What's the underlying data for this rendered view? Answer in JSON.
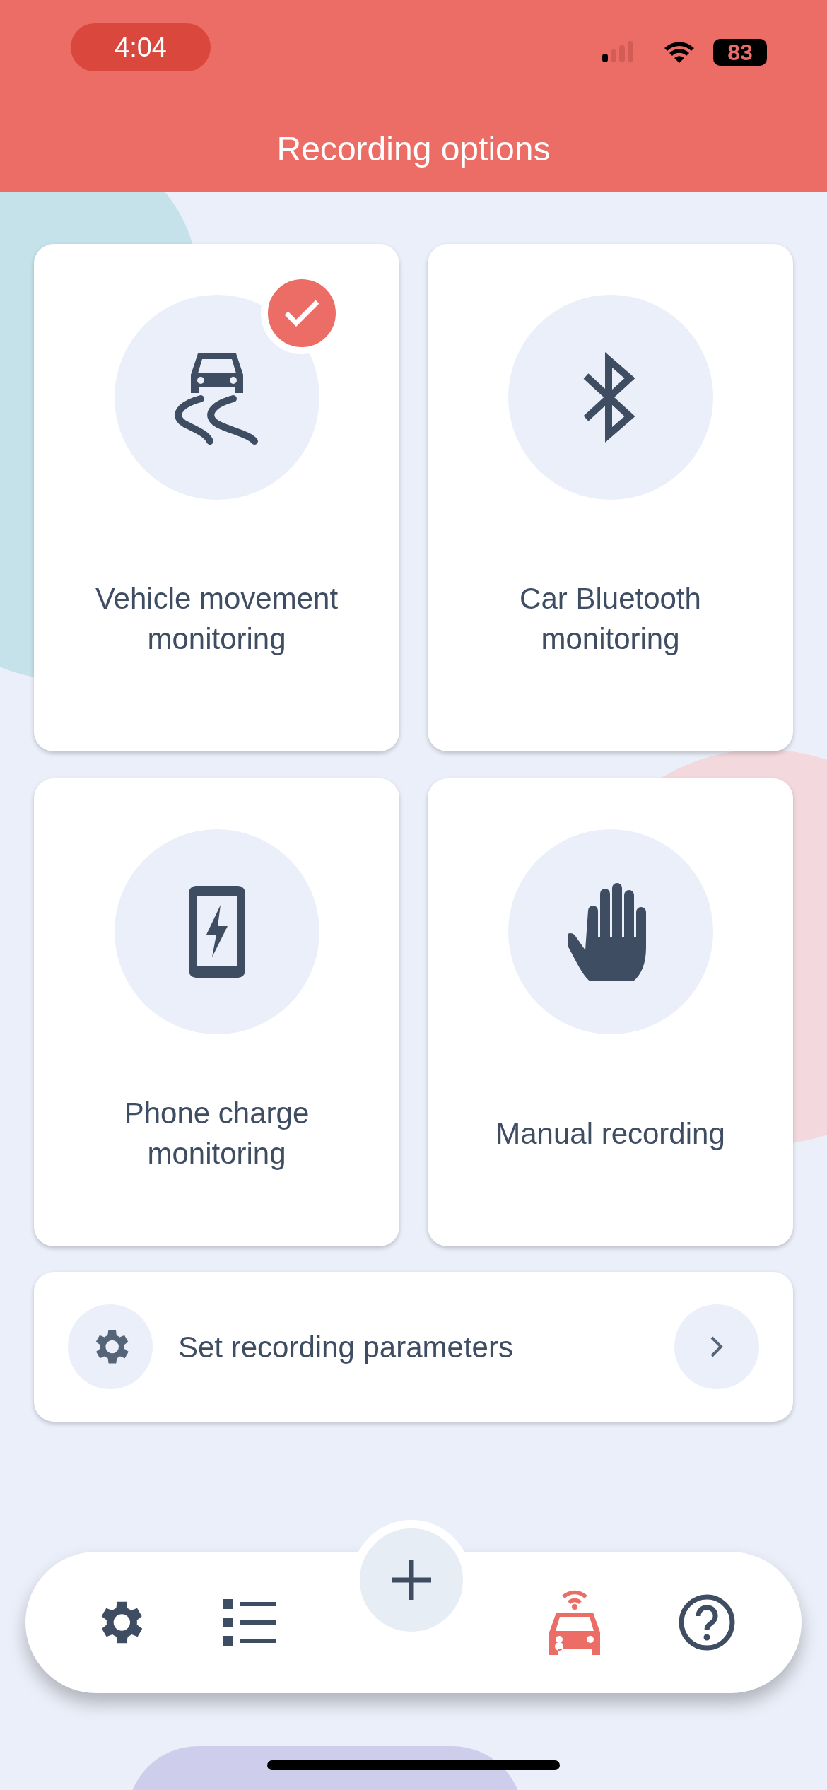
{
  "status_bar": {
    "time": "4:04",
    "battery": "83"
  },
  "header": {
    "title": "Recording options"
  },
  "options": [
    {
      "label": "Vehicle movement monitoring",
      "kind": "skid",
      "selected": true
    },
    {
      "label": "Car Bluetooth monitoring",
      "kind": "bluetooth",
      "selected": false
    },
    {
      "label": "Phone charge monitoring",
      "kind": "charge",
      "selected": false
    },
    {
      "label": "Manual recording",
      "kind": "hand",
      "selected": false
    }
  ],
  "parameters_row": {
    "label": "Set recording parameters"
  },
  "nav": [
    {
      "kind": "settings",
      "selected": false
    },
    {
      "kind": "list",
      "selected": false
    },
    {
      "kind": "add",
      "selected": false
    },
    {
      "kind": "car",
      "selected": true
    },
    {
      "kind": "help",
      "selected": false
    }
  ]
}
